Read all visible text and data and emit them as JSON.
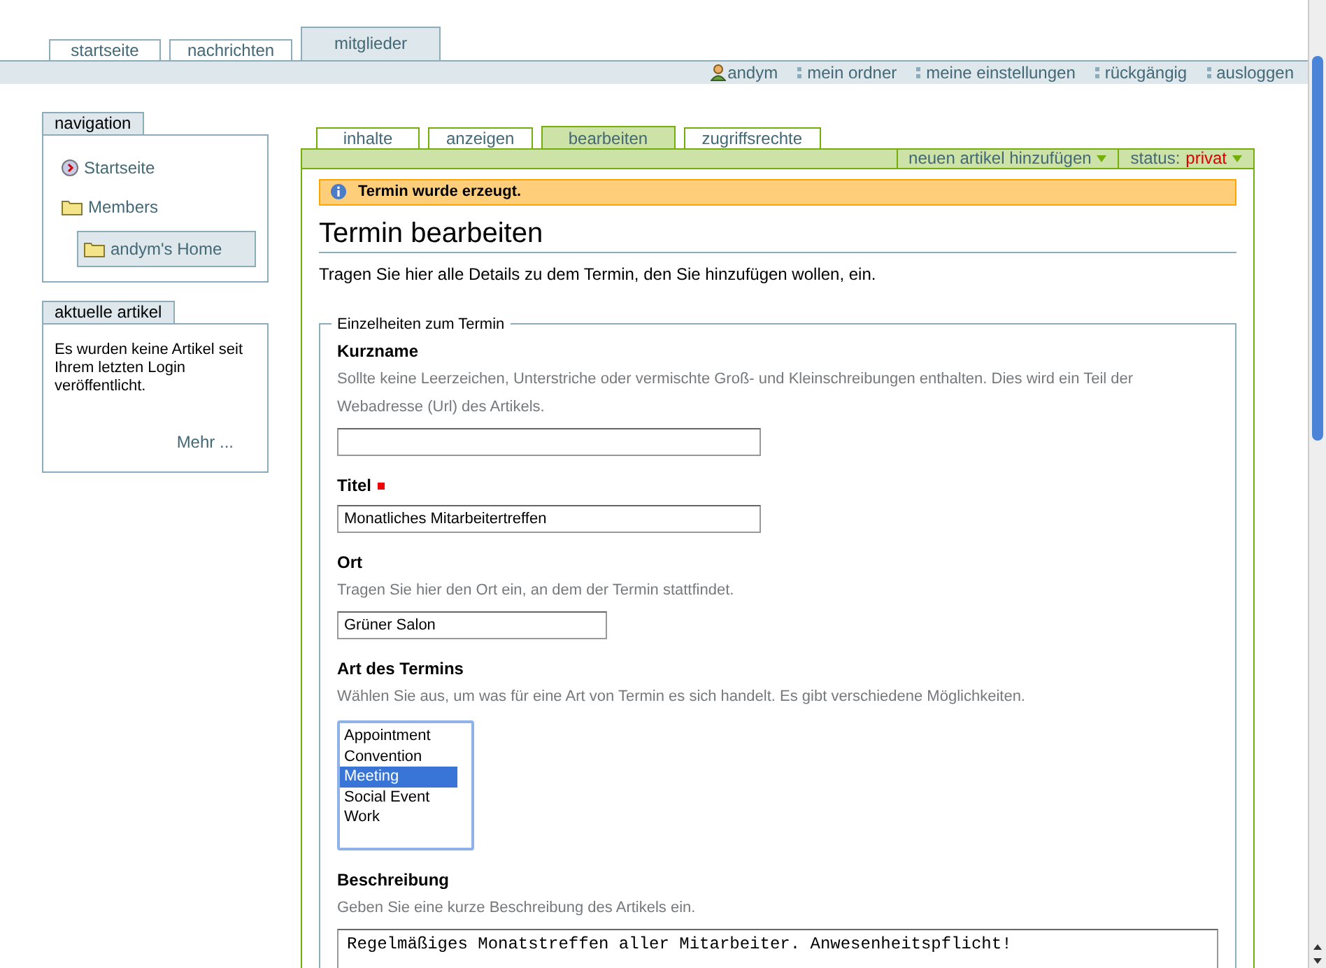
{
  "top_tabs": [
    {
      "label": "startseite",
      "selected": false
    },
    {
      "label": "nachrichten",
      "selected": false
    },
    {
      "label": "mitglieder",
      "selected": true
    }
  ],
  "user_bar": {
    "user": "andym",
    "links": [
      "mein ordner",
      "meine einstellungen",
      "rückgängig",
      "ausloggen"
    ]
  },
  "navigation": {
    "title": "navigation",
    "items": [
      {
        "label": "Startseite",
        "kind": "home",
        "selected": false
      },
      {
        "label": "Members",
        "kind": "folder",
        "selected": false,
        "children": [
          {
            "label": "andym's Home",
            "kind": "folder",
            "selected": true
          }
        ]
      }
    ]
  },
  "recent": {
    "title": "aktuelle artikel",
    "text": "Es wurden keine Artikel seit Ihrem letzten Login veröffentlicht.",
    "more": "Mehr ..."
  },
  "content_tabs": [
    {
      "label": "inhalte",
      "selected": false
    },
    {
      "label": "anzeigen",
      "selected": false
    },
    {
      "label": "bearbeiten",
      "selected": true
    },
    {
      "label": "zugriffsrechte",
      "selected": false
    }
  ],
  "actions": {
    "add_menu": "neuen artikel hinzufügen",
    "status_label": "status:",
    "status_value": "privat"
  },
  "message": "Termin wurde erzeugt.",
  "heading": "Termin bearbeiten",
  "description": "Tragen Sie hier alle Details zu dem Termin, den Sie hinzufügen wollen, ein.",
  "fieldset": {
    "legend": "Einzelheiten zum Termin",
    "fields": [
      {
        "kind": "text",
        "label": "Kurzname",
        "required": false,
        "help": "Sollte keine Leerzeichen, Unterstriche oder vermischte Groß- und Kleinschreibungen enthalten. Dies wird ein Teil der Webadresse (Url) des Artikels."
      },
      {
        "kind": "text",
        "label": "Titel",
        "required": true,
        "value": "Monatliches Mitarbeitertreffen"
      },
      {
        "kind": "short",
        "label": "Ort",
        "required": false,
        "help": "Tragen Sie hier den Ort ein, an dem der Termin stattfindet.",
        "value": "Grüner Salon"
      },
      {
        "kind": "list",
        "label": "Art des Termins",
        "required": false,
        "help": "Wählen Sie aus, um was für eine Art von Termin es sich handelt. Es gibt verschiedene Möglichkeiten.",
        "options": [
          {
            "label": "Appointment",
            "selected": false
          },
          {
            "label": "Convention",
            "selected": false
          },
          {
            "label": "Meeting",
            "selected": true
          },
          {
            "label": "Social Event",
            "selected": false
          },
          {
            "label": "Work",
            "selected": false
          }
        ]
      },
      {
        "kind": "textarea",
        "label": "Beschreibung",
        "required": false,
        "help": "Geben Sie eine kurze Beschreibung des Artikels ein.",
        "value": "Regelmäßiges Monatstreffen aller Mitarbeiter. Anwesenheitspflicht!"
      }
    ]
  }
}
